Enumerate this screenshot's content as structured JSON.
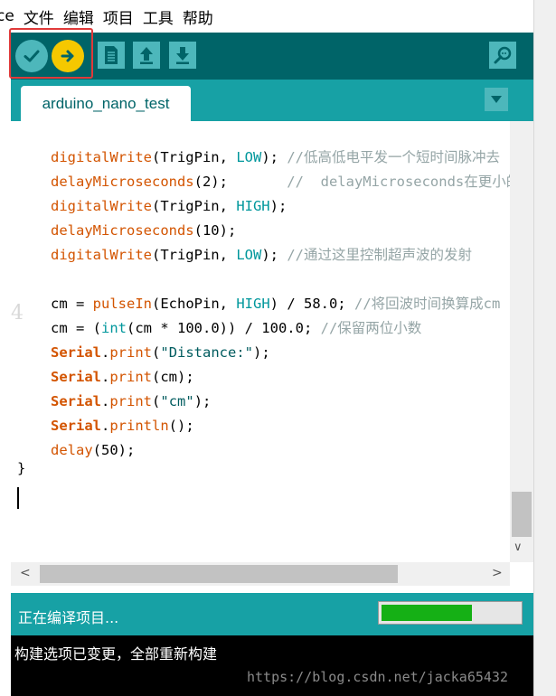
{
  "menu": {
    "items": [
      "ce",
      "文件",
      "编辑",
      "项目",
      "工具",
      "帮助"
    ]
  },
  "toolbar": {
    "buttons": [
      {
        "name": "verify",
        "icon": "check-icon"
      },
      {
        "name": "upload",
        "icon": "arrow-right-icon"
      },
      {
        "name": "new",
        "icon": "new-file-icon"
      },
      {
        "name": "open",
        "icon": "arrow-up-icon"
      },
      {
        "name": "save",
        "icon": "arrow-down-icon"
      },
      {
        "name": "serial-monitor",
        "icon": "magnifier-icon"
      }
    ]
  },
  "tabs": {
    "active": "arduino_nano_test"
  },
  "code": {
    "lines": [
      [
        {
          "t": "digitalWrite",
          "c": "kw-fn"
        },
        {
          "t": "(TrigPin, "
        },
        {
          "t": "LOW",
          "c": "kw-const"
        },
        {
          "t": "); "
        },
        {
          "t": "//低高低电平发一个短时间脉冲去",
          "c": "cm"
        }
      ],
      [
        {
          "t": "delayMicroseconds",
          "c": "kw-fn"
        },
        {
          "t": "(2);       "
        },
        {
          "t": "//  delayMicroseconds在更小的",
          "c": "cm"
        }
      ],
      [
        {
          "t": "digitalWrite",
          "c": "kw-fn"
        },
        {
          "t": "(TrigPin, "
        },
        {
          "t": "HIGH",
          "c": "kw-const"
        },
        {
          "t": ");"
        }
      ],
      [
        {
          "t": "delayMicroseconds",
          "c": "kw-fn"
        },
        {
          "t": "(10);"
        }
      ],
      [
        {
          "t": "digitalWrite",
          "c": "kw-fn"
        },
        {
          "t": "(TrigPin, "
        },
        {
          "t": "LOW",
          "c": "kw-const"
        },
        {
          "t": "); "
        },
        {
          "t": "//通过这里控制超声波的发射",
          "c": "cm"
        }
      ],
      [
        {
          "t": ""
        }
      ],
      [
        {
          "t": "cm = "
        },
        {
          "t": "pulseIn",
          "c": "kw-fn"
        },
        {
          "t": "(EchoPin, "
        },
        {
          "t": "HIGH",
          "c": "kw-const"
        },
        {
          "t": ") / 58.0; "
        },
        {
          "t": "//将回波时间换算成cm",
          "c": "cm"
        }
      ],
      [
        {
          "t": "cm = ("
        },
        {
          "t": "int",
          "c": "kw-const"
        },
        {
          "t": "(cm * 100.0)) / 100.0; "
        },
        {
          "t": "//保留两位小数",
          "c": "cm"
        }
      ],
      [
        {
          "t": "Serial",
          "c": "kw-ser"
        },
        {
          "t": "."
        },
        {
          "t": "print",
          "c": "kw-fn"
        },
        {
          "t": "("
        },
        {
          "t": "\"Distance:\"",
          "c": "str"
        },
        {
          "t": ");"
        }
      ],
      [
        {
          "t": "Serial",
          "c": "kw-ser"
        },
        {
          "t": "."
        },
        {
          "t": "print",
          "c": "kw-fn"
        },
        {
          "t": "(cm);"
        }
      ],
      [
        {
          "t": "Serial",
          "c": "kw-ser"
        },
        {
          "t": "."
        },
        {
          "t": "print",
          "c": "kw-fn"
        },
        {
          "t": "("
        },
        {
          "t": "\"cm\"",
          "c": "str"
        },
        {
          "t": ");"
        }
      ],
      [
        {
          "t": "Serial",
          "c": "kw-ser"
        },
        {
          "t": "."
        },
        {
          "t": "println",
          "c": "kw-fn"
        },
        {
          "t": "();"
        }
      ],
      [
        {
          "t": "delay",
          "c": "kw-fn"
        },
        {
          "t": "(50);"
        }
      ]
    ],
    "closing_brace": "}",
    "gutter_ghost": "4"
  },
  "status": {
    "text": "正在编译项目...",
    "progress_fraction": 0.66
  },
  "console": {
    "text": "构建选项已变更，全部重新构建"
  },
  "watermark": "https://blog.csdn.net/jacka65432",
  "colors": {
    "toolbar": "#006468",
    "tabbar": "#17a1a5",
    "button": "#4db7bb",
    "upload": "#f5c800",
    "progress_fill": "#15b015",
    "highlight": "#e03a3a"
  }
}
